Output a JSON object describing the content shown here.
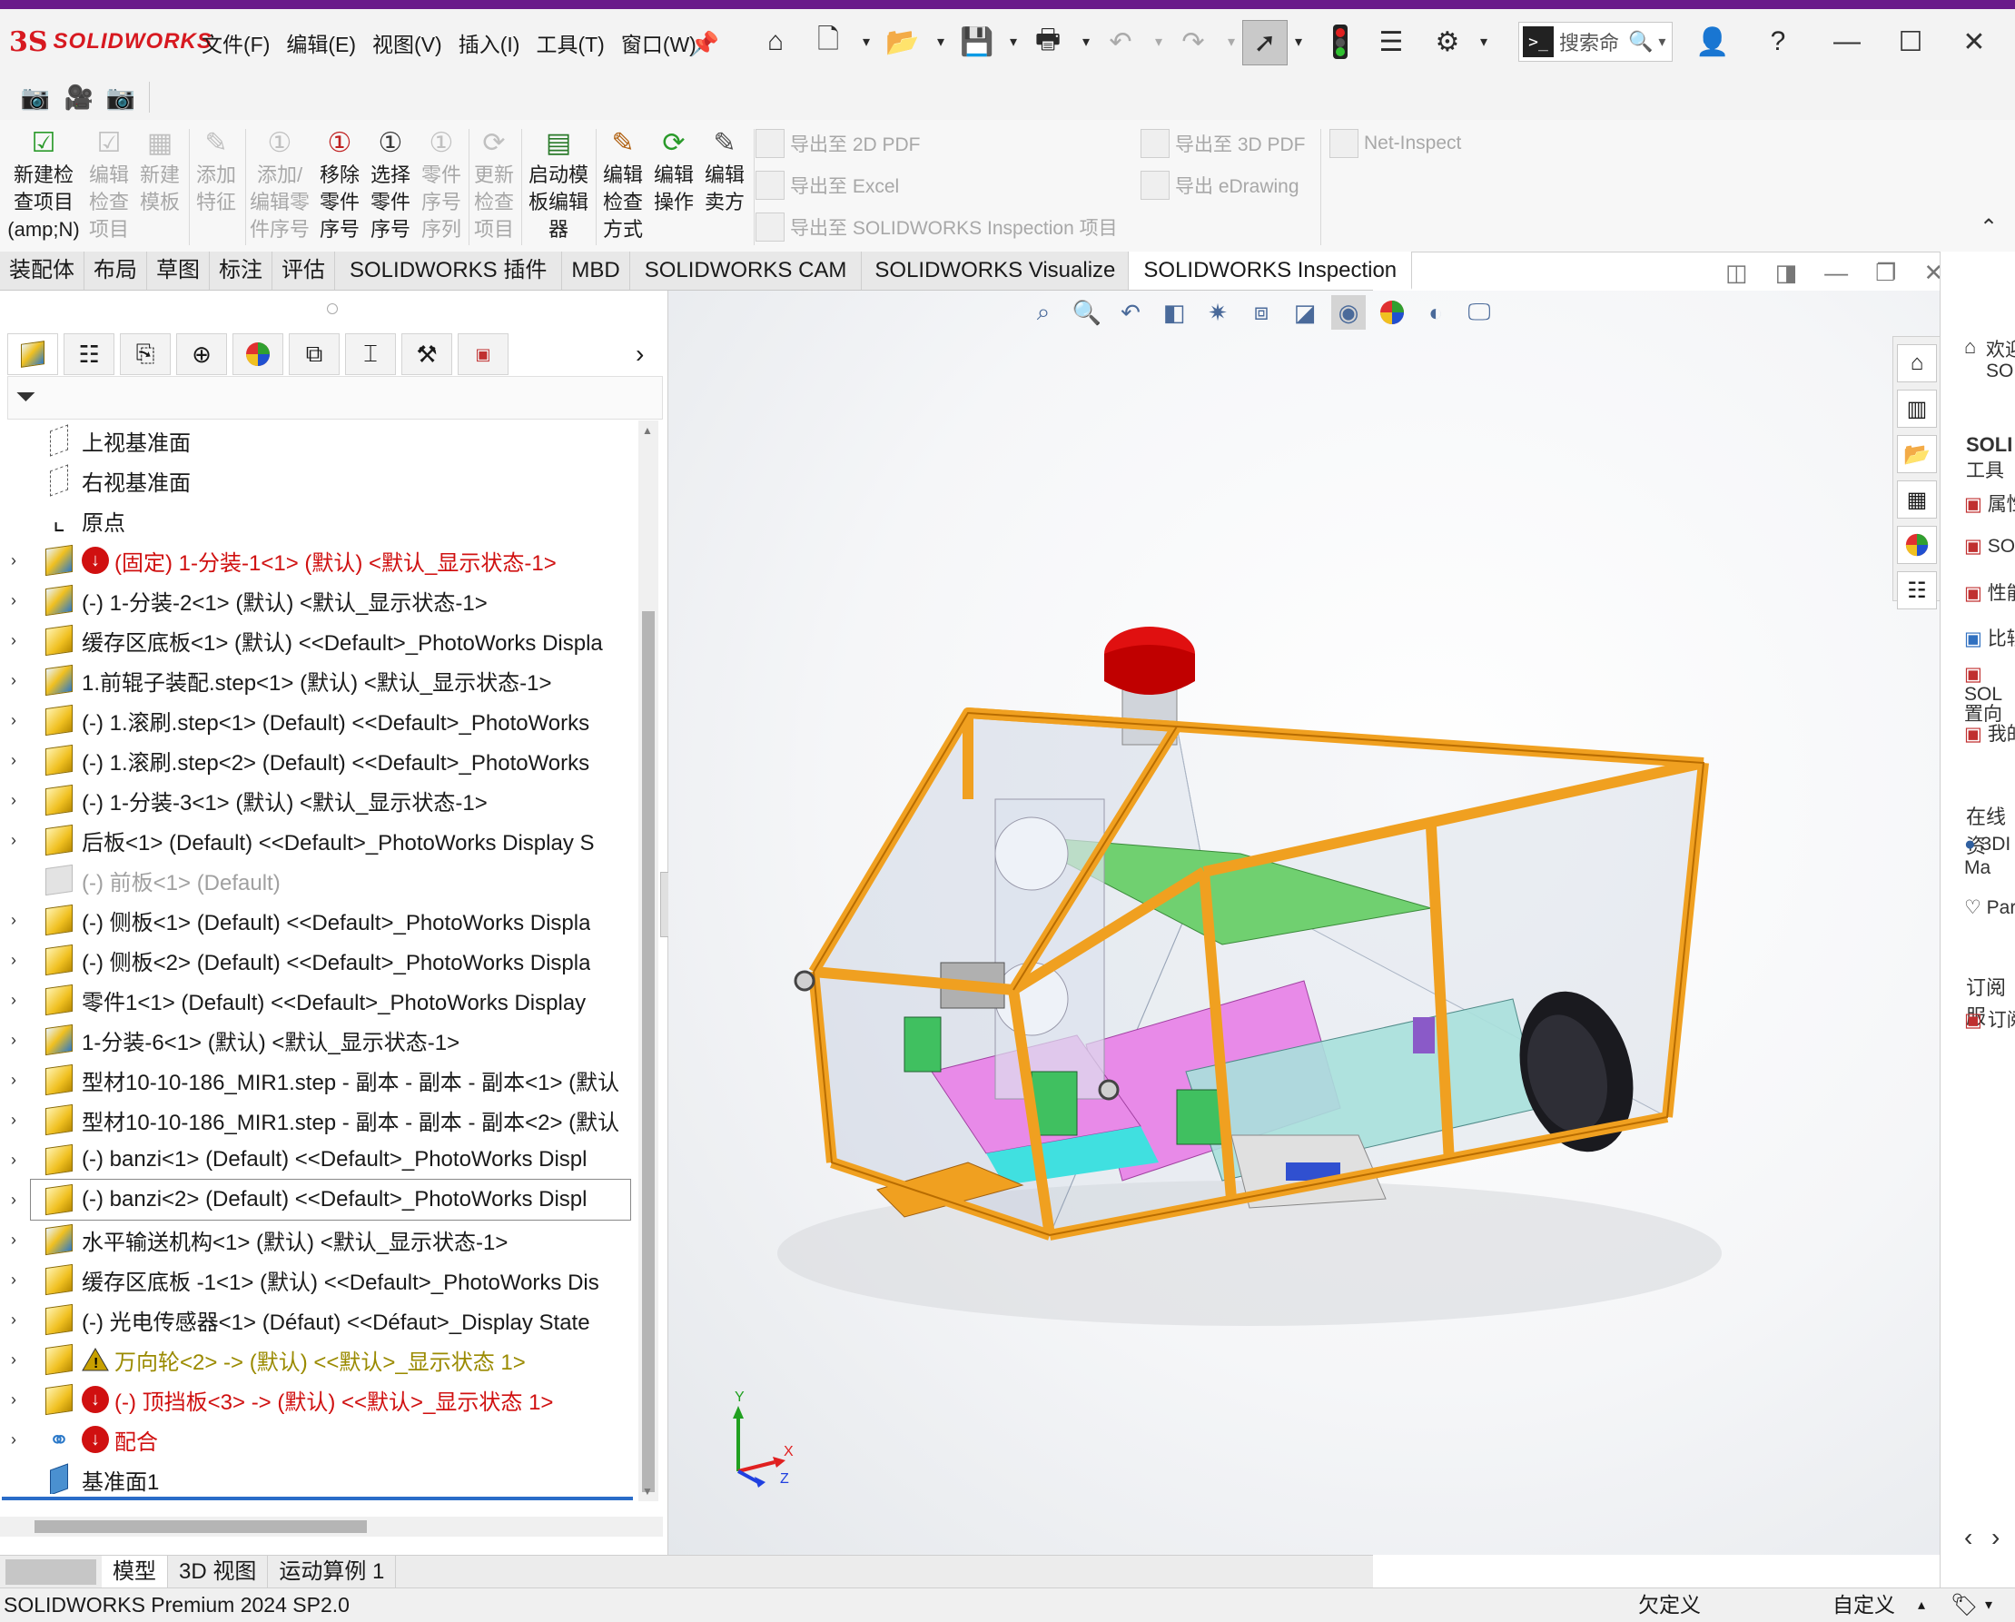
{
  "app": {
    "brand_ds": "3S",
    "brand_name": "SOLIDWORKS"
  },
  "menu": [
    "文件(F)",
    "编辑(E)",
    "视图(V)",
    "插入(I)",
    "工具(T)",
    "窗口(W)"
  ],
  "search": {
    "placeholder": "搜索命"
  },
  "command_manager": {
    "buttons": [
      {
        "label": "新建检\n查项目\n(amp;N)",
        "enabled": true
      },
      {
        "label": "编辑\n检查\n项目",
        "enabled": false
      },
      {
        "label": "新建\n模板",
        "enabled": false
      },
      {
        "label": "添加\n特征",
        "enabled": false
      },
      {
        "label": "添加/\n编辑零\n件序号",
        "enabled": false
      },
      {
        "label": "移除\n零件\n序号",
        "enabled": true
      },
      {
        "label": "选择\n零件\n序号",
        "enabled": true
      },
      {
        "label": "零件\n序号\n序列",
        "enabled": false
      },
      {
        "label": "更新\n检查\n项目",
        "enabled": false
      },
      {
        "label": "启动模\n板编辑\n器",
        "enabled": true
      },
      {
        "label": "编辑\n检查\n方式",
        "enabled": true
      },
      {
        "label": "编辑\n操作",
        "enabled": true
      },
      {
        "label": "编辑\n卖方",
        "enabled": true
      }
    ],
    "exports": [
      "导出至 2D PDF",
      "导出至 Excel",
      "导出至 SOLIDWORKS Inspection 项目",
      "导出至 3D PDF",
      "导出 eDrawing",
      "Net-Inspect"
    ]
  },
  "tabs": [
    "装配体",
    "布局",
    "草图",
    "标注",
    "评估",
    "SOLIDWORKS 插件",
    "MBD",
    "SOLIDWORKS CAM",
    "SOLIDWORKS Visualize",
    "SOLIDWORKS Inspection"
  ],
  "active_tab": "SOLIDWORKS Inspection",
  "tree": [
    {
      "label": "上视基准面",
      "icon": "plane",
      "expandable": false,
      "color": "#1a1a1a"
    },
    {
      "label": "右视基准面",
      "icon": "plane",
      "expandable": false,
      "color": "#1a1a1a"
    },
    {
      "label": "原点",
      "icon": "origin",
      "expandable": false,
      "color": "#1a1a1a"
    },
    {
      "label": "(固定) 1-分装-1<1> (默认) <默认_显示状态-1>",
      "icon": "assembly",
      "flag": "error",
      "expandable": true,
      "color": "#d01010"
    },
    {
      "label": "(-) 1-分装-2<1> (默认) <默认_显示状态-1>",
      "icon": "assembly",
      "expandable": true,
      "color": "#1a1a1a"
    },
    {
      "label": "缓存区底板<1> (默认) <<Default>_PhotoWorks Displa",
      "icon": "part",
      "expandable": true,
      "color": "#1a1a1a"
    },
    {
      "label": "1.前辊子装配.step<1> (默认) <默认_显示状态-1>",
      "icon": "assembly",
      "expandable": true,
      "color": "#1a1a1a"
    },
    {
      "label": "(-) 1.滚刷.step<1> (Default) <<Default>_PhotoWorks",
      "icon": "part",
      "expandable": true,
      "color": "#1a1a1a"
    },
    {
      "label": "(-) 1.滚刷.step<2> (Default) <<Default>_PhotoWorks",
      "icon": "part",
      "expandable": true,
      "color": "#1a1a1a"
    },
    {
      "label": "(-) 1-分装-3<1> (默认) <默认_显示状态-1>",
      "icon": "part",
      "expandable": true,
      "color": "#1a1a1a"
    },
    {
      "label": "后板<1> (Default) <<Default>_PhotoWorks Display S",
      "icon": "part",
      "expandable": true,
      "color": "#1a1a1a"
    },
    {
      "label": "(-) 前板<1> (Default)",
      "icon": "suppressed",
      "expandable": false,
      "color": "#a0a0a0"
    },
    {
      "label": "(-) 侧板<1> (Default) <<Default>_PhotoWorks Displa",
      "icon": "part",
      "expandable": true,
      "color": "#1a1a1a"
    },
    {
      "label": "(-) 侧板<2> (Default) <<Default>_PhotoWorks Displa",
      "icon": "part",
      "expandable": true,
      "color": "#1a1a1a"
    },
    {
      "label": "零件1<1> (Default) <<Default>_PhotoWorks Display",
      "icon": "part",
      "expandable": true,
      "color": "#1a1a1a"
    },
    {
      "label": "1-分装-6<1> (默认) <默认_显示状态-1>",
      "icon": "assembly",
      "expandable": true,
      "color": "#1a1a1a"
    },
    {
      "label": "型材10-10-186_MIR1.step - 副本 - 副本 - 副本<1> (默认",
      "icon": "part",
      "expandable": true,
      "color": "#1a1a1a"
    },
    {
      "label": "型材10-10-186_MIR1.step - 副本 - 副本 - 副本<2> (默认",
      "icon": "part",
      "expandable": true,
      "color": "#1a1a1a"
    },
    {
      "label": "(-) banzi<1> (Default) <<Default>_PhotoWorks Displ",
      "icon": "part",
      "expandable": true,
      "color": "#1a1a1a"
    },
    {
      "label": "(-) banzi<2> (Default) <<Default>_PhotoWorks Displ",
      "icon": "part",
      "expandable": true,
      "color": "#1a1a1a",
      "selected": true
    },
    {
      "label": "水平输送机构<1> (默认) <默认_显示状态-1>",
      "icon": "assembly",
      "expandable": true,
      "color": "#1a1a1a"
    },
    {
      "label": "缓存区底板 -1<1> (默认) <<Default>_PhotoWorks Dis",
      "icon": "part",
      "expandable": true,
      "color": "#1a1a1a"
    },
    {
      "label": "(-) 光电传感器<1> (Défaut) <<Défaut>_Display State",
      "icon": "part",
      "expandable": true,
      "color": "#1a1a1a"
    },
    {
      "label": "万向轮<2> -> (默认) <<默认>_显示状态 1>",
      "icon": "part",
      "flag": "warning",
      "expandable": true,
      "color": "#9a8a00"
    },
    {
      "label": "(-) 顶挡板<3> -> (默认) <<默认>_显示状态 1>",
      "icon": "part",
      "flag": "error",
      "expandable": true,
      "color": "#d01010"
    },
    {
      "label": "配合",
      "icon": "mates",
      "flag": "error",
      "expandable": true,
      "color": "#d01010"
    },
    {
      "label": "基准面1",
      "icon": "plane-blue",
      "expandable": false,
      "color": "#1a1a1a"
    }
  ],
  "bottom_tabs": [
    "模型",
    "3D 视图",
    "运动算例 1"
  ],
  "status": {
    "product": "SOLIDWORKS Premium 2024 SP2.0",
    "definition": "欠定义",
    "units": "自定义"
  },
  "triad": {
    "x": "X",
    "y": "Y",
    "z": "Z"
  },
  "task_pane": {
    "welcome": "欢迎",
    "welcome_sub": "SOL",
    "tools_title": "SOLI",
    "tools_sub": "工具",
    "items": [
      "属性",
      "SOL",
      "性能",
      "比较",
      "SOL\n置向",
      "我的"
    ],
    "online_title": "在线资",
    "online_items": [
      "3DI\nMa",
      "Par"
    ],
    "subscribe_title": "订阅服",
    "subscribe_items": [
      "订阅"
    ]
  },
  "colors": {
    "brand": "#d71920",
    "accent_bar": "#6a1b8a",
    "frame": "#f0a020",
    "error": "#d01010",
    "warning": "#c8a000"
  }
}
